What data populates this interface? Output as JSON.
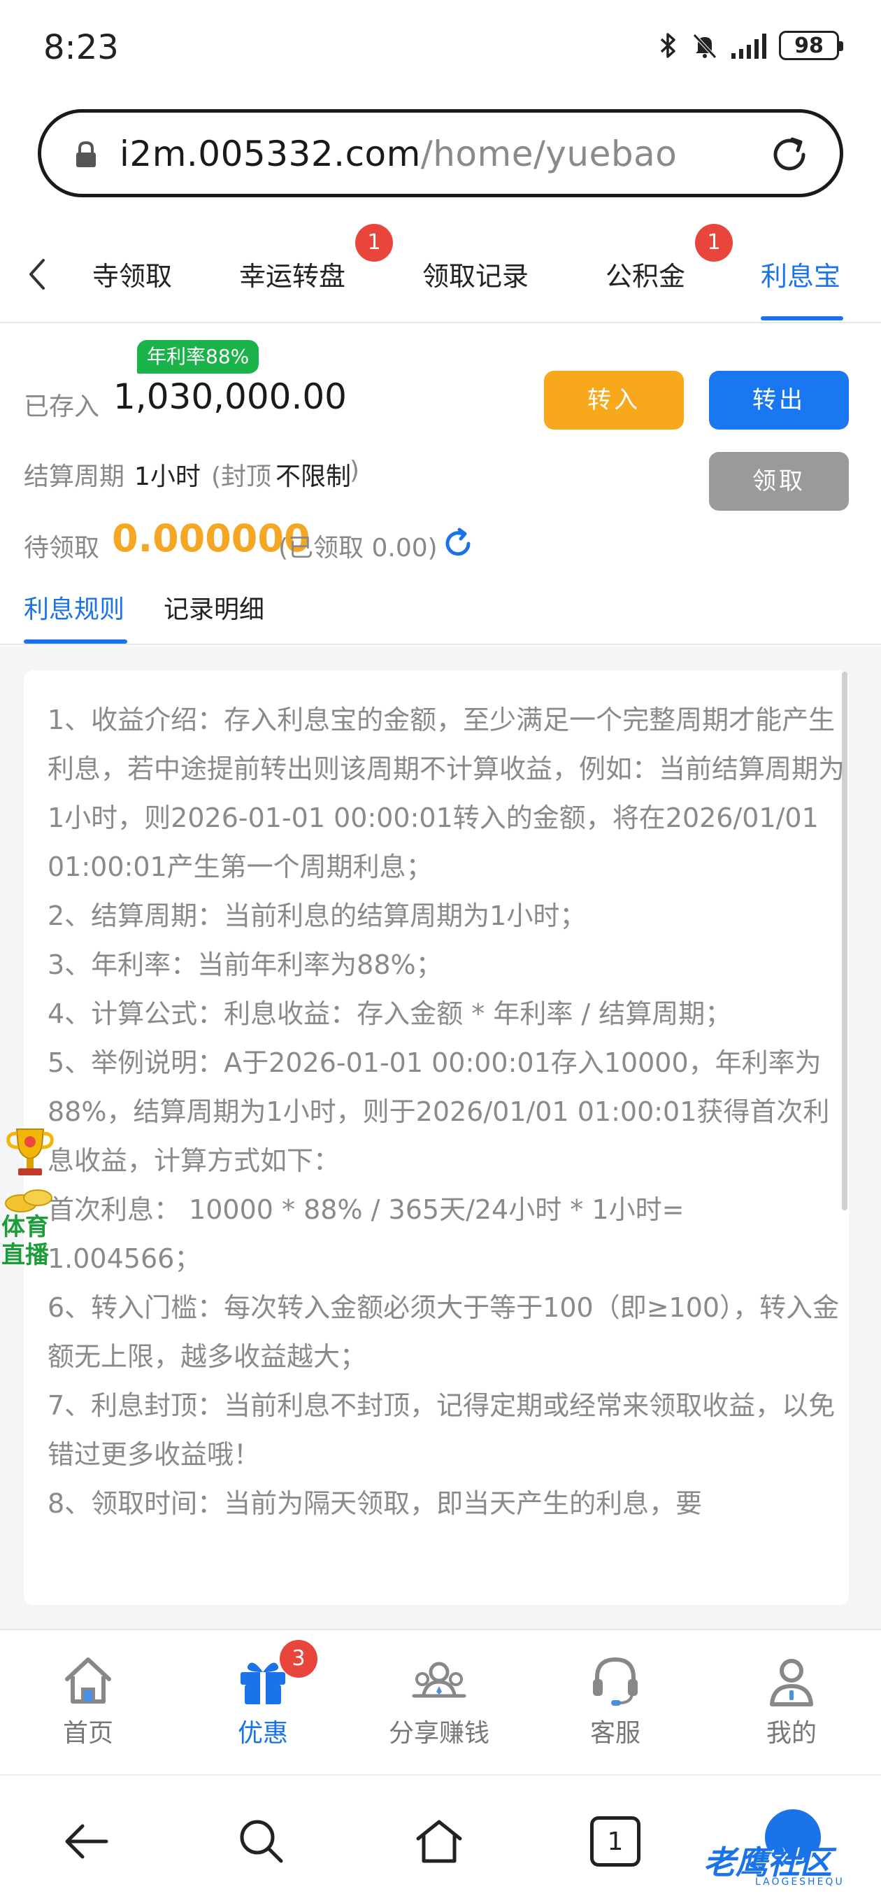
{
  "status_bar": {
    "time": "8:23",
    "battery": "98",
    "icons": [
      "bluetooth-icon",
      "mute-icon",
      "signal-icon",
      "battery-icon"
    ]
  },
  "browser": {
    "url_host": "i2m.005332.com",
    "url_path": "/home/yuebao"
  },
  "tabs": [
    {
      "label": "寺领取",
      "badge": ""
    },
    {
      "label": "幸运转盘",
      "badge": "1"
    },
    {
      "label": "领取记录",
      "badge": ""
    },
    {
      "label": "公积金",
      "badge": "1"
    },
    {
      "label": "利息宝",
      "badge": "",
      "active": true
    }
  ],
  "summary": {
    "rate_tag": "年利率88%",
    "deposited_label": "已存入",
    "deposited_value": "1,030,000.00",
    "cycle_label": "结算周期",
    "cycle_value": "1小时",
    "cap_open": "(封顶",
    "cap_value": "不限制",
    "cap_close": ")",
    "pending_label": "待领取",
    "pending_value": "0.000000",
    "claimed_text": "(已领取 0.00)",
    "btn_in": "转入",
    "btn_out": "转出",
    "btn_claim": "领取"
  },
  "sub_tabs": [
    {
      "label": "利息规则",
      "active": true
    },
    {
      "label": "记录明细",
      "active": false
    }
  ],
  "rules": [
    "1、收益介绍：存入利息宝的金额，至少满足一个完整周期才能产生利息，若中途提前转出则该周期不计算收益，例如：当前结算周期为1小时，则2026-01-01 00:00:01转入的金额，将在2026/01/01 01:00:01产生第一个周期利息；",
    "2、结算周期：当前利息的结算周期为1小时；",
    "3、年利率：当前年利率为88%；",
    "4、计算公式：利息收益：存入金额 * 年利率 / 结算周期；",
    "5、举例说明：A于2026-01-01 00:00:01存入10000，年利率为88%，结算周期为1小时，则于2026/01/01 01:00:01获得首次利息收益，计算方式如下：",
    "首次利息： 10000 * 88% / 365天/24小时 * 1小时= 1.004566；",
    "6、转入门槛：每次转入金额必须大于等于100（即≥100），转入金额无上限，越多收益越大；",
    "7、利息封顶：当前利息不封顶，记得定期或经常来领取收益，以免错过更多收益哦！",
    "8、领取时间：当前为隔天领取，即当天产生的利息，要"
  ],
  "float_widget": {
    "line1": "体育",
    "line2": "直播"
  },
  "bottom_nav": [
    {
      "label": "首页",
      "icon": "home-icon",
      "badge": ""
    },
    {
      "label": "优惠",
      "icon": "gift-icon",
      "badge": "3",
      "active": true
    },
    {
      "label": "分享赚钱",
      "icon": "share-icon",
      "badge": ""
    },
    {
      "label": "客服",
      "icon": "headset-icon",
      "badge": ""
    },
    {
      "label": "我的",
      "icon": "profile-icon",
      "badge": ""
    }
  ],
  "system_nav": {
    "tab_count": "1",
    "icons": [
      "back-icon",
      "search-icon",
      "home-icon",
      "tabs-icon"
    ]
  },
  "watermark": {
    "text": "老鹰社区",
    "sub": "LAOGESHEQU"
  },
  "colors": {
    "accent": "#1a73e8",
    "orange": "#f8a81b",
    "blue_button": "#1977f2",
    "gray_button": "#9a9a9a",
    "badge_red": "#e8453c",
    "rate_green": "#19b34a",
    "pending_amount": "#f5a623"
  }
}
